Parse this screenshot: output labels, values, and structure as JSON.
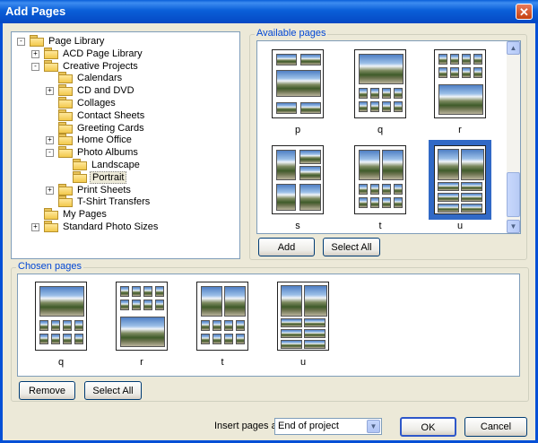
{
  "window": {
    "title": "Add Pages",
    "close_glyph": "✕"
  },
  "tree": [
    {
      "label": "Page Library",
      "indent": 0,
      "toggle": "-"
    },
    {
      "label": "ACD Page Library",
      "indent": 1,
      "toggle": "+"
    },
    {
      "label": "Creative Projects",
      "indent": 1,
      "toggle": "-"
    },
    {
      "label": "Calendars",
      "indent": 2,
      "toggle": ""
    },
    {
      "label": "CD and DVD",
      "indent": 2,
      "toggle": "+"
    },
    {
      "label": "Collages",
      "indent": 2,
      "toggle": ""
    },
    {
      "label": "Contact Sheets",
      "indent": 2,
      "toggle": ""
    },
    {
      "label": "Greeting Cards",
      "indent": 2,
      "toggle": ""
    },
    {
      "label": "Home Office",
      "indent": 2,
      "toggle": "+"
    },
    {
      "label": "Photo Albums",
      "indent": 2,
      "toggle": "-"
    },
    {
      "label": "Landscape",
      "indent": 3,
      "toggle": ""
    },
    {
      "label": "Portrait",
      "indent": 3,
      "toggle": "",
      "selected": true
    },
    {
      "label": "Print Sheets",
      "indent": 2,
      "toggle": "+"
    },
    {
      "label": "T-Shirt Transfers",
      "indent": 2,
      "toggle": ""
    },
    {
      "label": "My Pages",
      "indent": 1,
      "toggle": ""
    },
    {
      "label": "Standard Photo Sizes",
      "indent": 1,
      "toggle": "+"
    }
  ],
  "available": {
    "label": "Available pages",
    "pages": [
      {
        "name": "p",
        "layout": "p"
      },
      {
        "name": "q",
        "layout": "q"
      },
      {
        "name": "r",
        "layout": "r"
      },
      {
        "name": "s",
        "layout": "s"
      },
      {
        "name": "t",
        "layout": "t"
      },
      {
        "name": "u",
        "layout": "u",
        "selected": true
      }
    ],
    "add_label": "Add",
    "select_all_label": "Select All"
  },
  "chosen": {
    "label": "Chosen pages",
    "pages": [
      {
        "name": "q",
        "layout": "q"
      },
      {
        "name": "r",
        "layout": "r"
      },
      {
        "name": "t",
        "layout": "t"
      },
      {
        "name": "u",
        "layout": "u"
      }
    ],
    "remove_label": "Remove",
    "select_all_label": "Select All"
  },
  "footer": {
    "insert_label": "Insert pages at:",
    "insert_value": "End of project",
    "ok_label": "OK",
    "cancel_label": "Cancel"
  },
  "icons": {
    "folder": "folder-icon",
    "scroll_up": "▲",
    "scroll_down": "▼",
    "dropdown": "▼"
  }
}
